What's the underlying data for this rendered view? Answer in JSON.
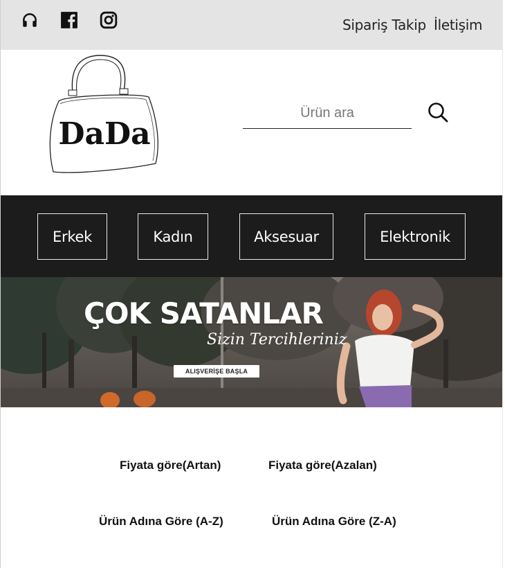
{
  "topbar": {
    "social_icons": [
      "headphones-icon",
      "facebook-icon",
      "instagram-icon"
    ],
    "links": [
      "Sipariş Takip",
      "İletişim"
    ]
  },
  "header": {
    "logo_text": "DaDa",
    "search": {
      "placeholder": "Ürün ara",
      "value": ""
    },
    "search_icon": "search-icon"
  },
  "categories": [
    "Erkek",
    "Kadın",
    "Aksesuar",
    "Elektronik"
  ],
  "banner": {
    "title": "ÇOK SATANLAR",
    "subtitle": "Sizin Tercihleriniz",
    "button": "ALIŞVERİŞE BAŞLA"
  },
  "sort": {
    "price_asc": "Fiyata göre(Artan)",
    "price_desc": "Fiyata göre(Azalan)",
    "name_asc": "Ürün Adına Göre (A-Z)",
    "name_desc": "Ürün Adına Göre (Z-A)"
  },
  "colors": {
    "topbar_bg": "#e4e4e4",
    "nav_bg": "#1c1c1c",
    "text": "#222222"
  }
}
